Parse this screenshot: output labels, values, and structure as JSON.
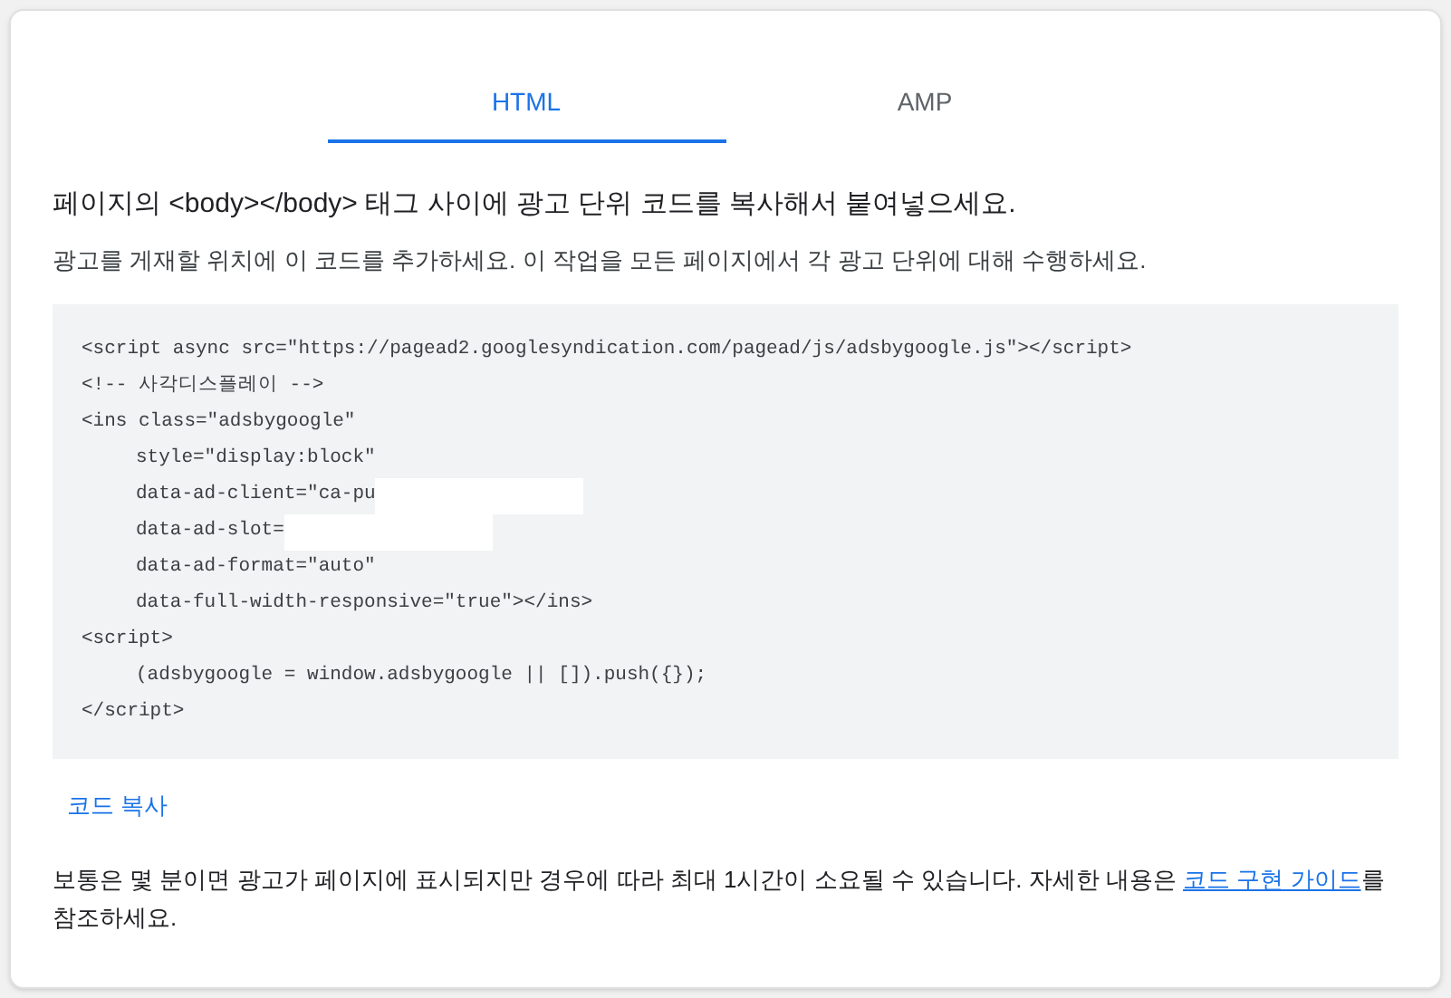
{
  "tabs": [
    {
      "label": "HTML",
      "selected": true
    },
    {
      "label": "AMP",
      "selected": false
    }
  ],
  "heading": "페이지의 <body></body> 태그 사이에 광고 단위 코드를 복사해서 붙여넣으세요.",
  "subheading": "광고를 게재할 위치에 이 코드를 추가하세요. 이 작업을 모든 페이지에서 각 광고 단위에 대해 수행하세요.",
  "code_lines": [
    {
      "text": "<script async src=\"https://pagead2.googlesyndication.com/pagead/js/adsbygoogle.js\"></script>",
      "indent": false,
      "redacted": false
    },
    {
      "text": "<!-- 사각디스플레이 -->",
      "indent": false,
      "redacted": false
    },
    {
      "text": "<ins class=\"adsbygoogle\"",
      "indent": false,
      "redacted": false
    },
    {
      "text": "style=\"display:block\"",
      "indent": true,
      "redacted": false
    },
    {
      "text": "data-ad-client=\"ca-pu",
      "indent": true,
      "redacted": true
    },
    {
      "text": "data-ad-slot=",
      "indent": true,
      "redacted": true
    },
    {
      "text": "data-ad-format=\"auto\"",
      "indent": true,
      "redacted": false
    },
    {
      "text": "data-full-width-responsive=\"true\"></ins>",
      "indent": true,
      "redacted": false
    },
    {
      "text": "<script>",
      "indent": false,
      "redacted": false
    },
    {
      "text": "(adsbygoogle = window.adsbygoogle || []).push({});",
      "indent": true,
      "redacted": false
    },
    {
      "text": "</script>",
      "indent": false,
      "redacted": false
    }
  ],
  "copy_button": "코드 복사",
  "note": {
    "before": "보통은 몇 분이면 광고가 페이지에 표시되지만 경우에 따라 최대 1시간이 소요될 수 있습니다. 자세한 내용은 ",
    "link": "코드 구현 가이드",
    "after": "를 참조하세요."
  }
}
